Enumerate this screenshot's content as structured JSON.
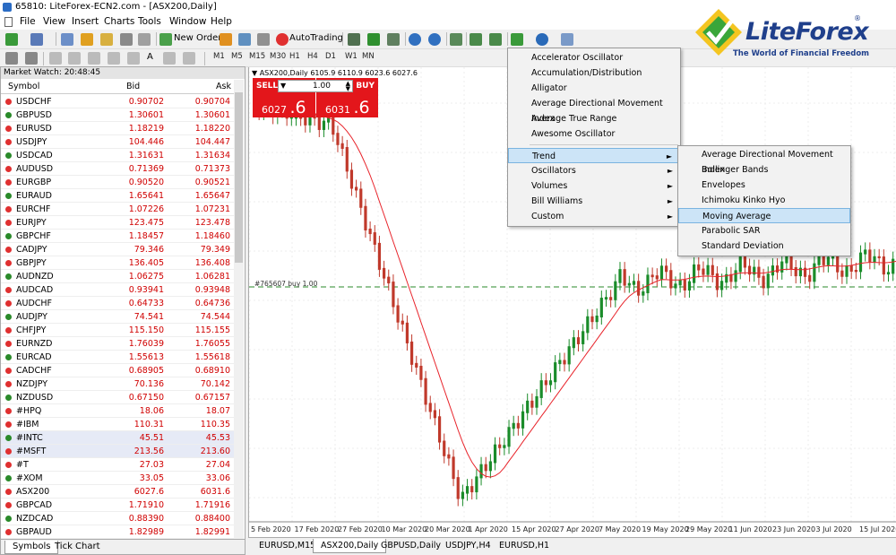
{
  "window": {
    "title": "65810: LiteForex-ECN2.com - [ASX200,Daily]"
  },
  "menu": [
    "File",
    "View",
    "Insert",
    "Charts",
    "Tools",
    "Window",
    "Help"
  ],
  "toolbar": {
    "new_order": "New Order",
    "autotrading": "AutoTrading"
  },
  "timeframes": [
    "M1",
    "M5",
    "M15",
    "M30",
    "H1",
    "H4",
    "D1",
    "W1",
    "MN"
  ],
  "drawing_tools": {
    "text_tool": "A"
  },
  "logo": {
    "brand": "LiteForex",
    "tagline": "The World of Financial Freedom",
    "reg": "®"
  },
  "market_watch": {
    "header": "Market Watch: 20:48:45",
    "columns": {
      "symbol": "Symbol",
      "bid": "Bid",
      "ask": "Ask"
    },
    "rows": [
      {
        "symbol": "USDCHF",
        "bid": "0.90702",
        "ask": "0.90704"
      },
      {
        "symbol": "GBPUSD",
        "bid": "1.30601",
        "ask": "1.30601"
      },
      {
        "symbol": "EURUSD",
        "bid": "1.18219",
        "ask": "1.18220"
      },
      {
        "symbol": "USDJPY",
        "bid": "104.446",
        "ask": "104.447"
      },
      {
        "symbol": "USDCAD",
        "bid": "1.31631",
        "ask": "1.31634"
      },
      {
        "symbol": "AUDUSD",
        "bid": "0.71369",
        "ask": "0.71373"
      },
      {
        "symbol": "EURGBP",
        "bid": "0.90520",
        "ask": "0.90521"
      },
      {
        "symbol": "EURAUD",
        "bid": "1.65641",
        "ask": "1.65647"
      },
      {
        "symbol": "EURCHF",
        "bid": "1.07226",
        "ask": "1.07231"
      },
      {
        "symbol": "EURJPY",
        "bid": "123.475",
        "ask": "123.478"
      },
      {
        "symbol": "GBPCHF",
        "bid": "1.18457",
        "ask": "1.18460"
      },
      {
        "symbol": "CADJPY",
        "bid": "79.346",
        "ask": "79.349"
      },
      {
        "symbol": "GBPJPY",
        "bid": "136.405",
        "ask": "136.408"
      },
      {
        "symbol": "AUDNZD",
        "bid": "1.06275",
        "ask": "1.06281"
      },
      {
        "symbol": "AUDCAD",
        "bid": "0.93941",
        "ask": "0.93948"
      },
      {
        "symbol": "AUDCHF",
        "bid": "0.64733",
        "ask": "0.64736"
      },
      {
        "symbol": "AUDJPY",
        "bid": "74.541",
        "ask": "74.544"
      },
      {
        "symbol": "CHFJPY",
        "bid": "115.150",
        "ask": "115.155"
      },
      {
        "symbol": "EURNZD",
        "bid": "1.76039",
        "ask": "1.76055"
      },
      {
        "symbol": "EURCAD",
        "bid": "1.55613",
        "ask": "1.55618"
      },
      {
        "symbol": "CADCHF",
        "bid": "0.68905",
        "ask": "0.68910"
      },
      {
        "symbol": "NZDJPY",
        "bid": "70.136",
        "ask": "70.142"
      },
      {
        "symbol": "NZDUSD",
        "bid": "0.67150",
        "ask": "0.67157"
      },
      {
        "symbol": "#HPQ",
        "bid": "18.06",
        "ask": "18.07"
      },
      {
        "symbol": "#IBM",
        "bid": "110.31",
        "ask": "110.35"
      },
      {
        "symbol": "#INTC",
        "bid": "45.51",
        "ask": "45.53"
      },
      {
        "symbol": "#MSFT",
        "bid": "213.56",
        "ask": "213.60"
      },
      {
        "symbol": "#T",
        "bid": "27.03",
        "ask": "27.04"
      },
      {
        "symbol": "#XOM",
        "bid": "33.05",
        "ask": "33.06"
      },
      {
        "symbol": "ASX200",
        "bid": "6027.6",
        "ask": "6031.6"
      },
      {
        "symbol": "GBPCAD",
        "bid": "1.71910",
        "ask": "1.71916"
      },
      {
        "symbol": "NZDCAD",
        "bid": "0.88390",
        "ask": "0.88400"
      },
      {
        "symbol": "GBPAUD",
        "bid": "1.82989",
        "ask": "1.82991"
      }
    ],
    "highlighted_rows": [
      25,
      26
    ],
    "tabs": [
      "Symbols",
      "Tick Chart"
    ]
  },
  "chart": {
    "info": "▼ ASX200,Daily  6105.9 6110.9 6023.6 6027.6",
    "trade_panel": {
      "sell_label": "SELL",
      "buy_label": "BUY",
      "lot": "1.00",
      "sell_price_main": "6027",
      "sell_price_big": ".6",
      "buy_price_main": "6031",
      "buy_price_big": ".6"
    },
    "order_line_label": "#765607 buy 1.00",
    "x_labels": [
      "5 Feb 2020",
      "17 Feb 2020",
      "27 Feb 2020",
      "10 Mar 2020",
      "20 Mar 2020",
      "1 Apr 2020",
      "15 Apr 2020",
      "27 Apr 2020",
      "7 May 2020",
      "19 May 2020",
      "29 May 2020",
      "11 Jun 2020",
      "23 Jun 2020",
      "3 Jul 2020",
      "15 Jul 2020"
    ],
    "colors": {
      "up": "#1a8c2a",
      "down": "#c0392b",
      "ma": "#e8232a",
      "order_line": "#2a8a2a"
    }
  },
  "chart_tabs": [
    "EURUSD,M15",
    "ASX200,Daily",
    "GBPUSD,Daily",
    "USDJPY,H4",
    "EURUSD,H1"
  ],
  "indicator_menu": {
    "items": [
      "Accelerator Oscillator",
      "Accumulation/Distribution",
      "Alligator",
      "Average Directional Movement Index",
      "Average True Range",
      "Awesome Oscillator"
    ],
    "submenus": [
      "Trend",
      "Oscillators",
      "Volumes",
      "Bill Williams",
      "Custom"
    ],
    "selected": "Trend"
  },
  "trend_menu": {
    "items": [
      "Average Directional Movement Index",
      "Bollinger Bands",
      "Envelopes",
      "Ichimoku Kinko Hyo",
      "Moving Average",
      "Parabolic SAR",
      "Standard Deviation"
    ],
    "selected": "Moving Average"
  }
}
